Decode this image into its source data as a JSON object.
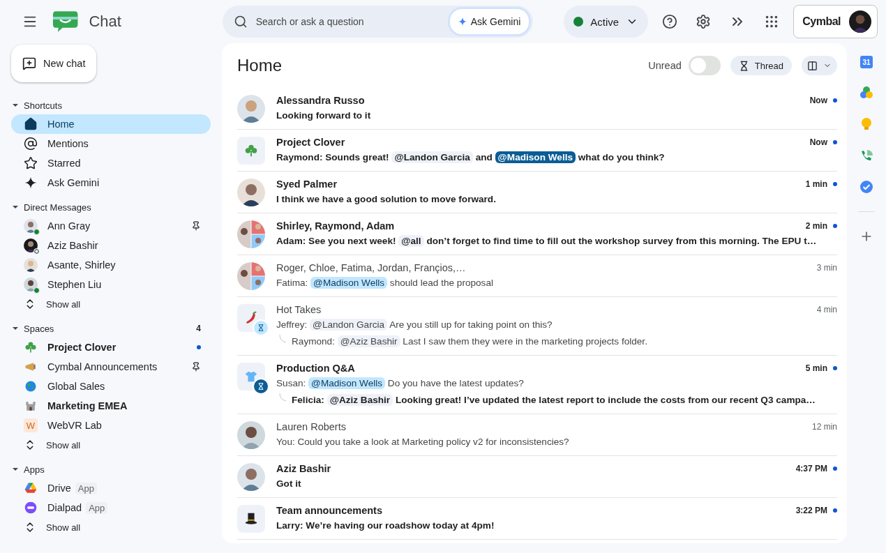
{
  "header": {
    "app_name": "Chat",
    "search": {
      "placeholder": "Search or ask a question"
    },
    "ask_button": "Ask Gemini",
    "status": {
      "label": "Active",
      "color": "#188038"
    },
    "account": {
      "brand": "Cymbal"
    }
  },
  "new_chat": "New chat",
  "sidebar": {
    "sections": [
      {
        "title": "Shortcuts",
        "expanded": true,
        "items": [
          {
            "kind": "home",
            "label": "Home",
            "selected": true,
            "bold": false,
            "pinned": false,
            "unread": false
          },
          {
            "kind": "mentions",
            "label": "Mentions",
            "selected": false,
            "bold": false,
            "pinned": false,
            "unread": false
          },
          {
            "kind": "starred",
            "label": "Starred",
            "selected": false,
            "bold": false,
            "pinned": false,
            "unread": false
          },
          {
            "kind": "gemini",
            "label": "Ask Gemini",
            "selected": false,
            "bold": false,
            "pinned": false,
            "unread": false
          }
        ]
      },
      {
        "title": "Direct Messages",
        "expanded": true,
        "items": [
          {
            "kind": "person",
            "label": "Ann Gray",
            "online": true,
            "away": false,
            "selected": false,
            "bold": false,
            "pinned": true,
            "unread": false
          },
          {
            "kind": "person",
            "label": "Aziz Bashir",
            "online": false,
            "away": true,
            "selected": false,
            "bold": false,
            "pinned": false,
            "unread": false
          },
          {
            "kind": "person",
            "label": "Asante, Shirley",
            "online": false,
            "away": false,
            "selected": false,
            "bold": false,
            "pinned": false,
            "unread": false
          },
          {
            "kind": "person",
            "label": "Stephen Liu",
            "online": true,
            "away": false,
            "selected": false,
            "bold": false,
            "pinned": false,
            "unread": false
          },
          {
            "kind": "showall",
            "label": "Show all",
            "selected": false,
            "pinned": false,
            "unread": false
          }
        ]
      },
      {
        "title": "Spaces",
        "count": "4",
        "expanded": true,
        "items": [
          {
            "kind": "clover",
            "label": "Project Clover",
            "selected": false,
            "bold": true,
            "pinned": false,
            "unread": true
          },
          {
            "kind": "megaphone",
            "label": "Cymbal Announcements",
            "selected": false,
            "bold": false,
            "pinned": true,
            "unread": false
          },
          {
            "kind": "globe",
            "label": "Global Sales",
            "selected": false,
            "bold": false,
            "pinned": false,
            "unread": false
          },
          {
            "kind": "castle",
            "label": "Marketing EMEA",
            "selected": false,
            "bold": true,
            "pinned": false,
            "unread": false
          },
          {
            "kind": "letter",
            "letter": "W",
            "label": "WebVR Lab",
            "selected": false,
            "bold": false,
            "pinned": false,
            "unread": false
          },
          {
            "kind": "showall",
            "label": "Show all",
            "selected": false,
            "pinned": false,
            "unread": false
          }
        ]
      },
      {
        "title": "Apps",
        "expanded": true,
        "items": [
          {
            "kind": "drive",
            "label": "Drive",
            "tag": "App",
            "selected": false,
            "bold": false,
            "pinned": false,
            "unread": false
          },
          {
            "kind": "dialpad",
            "label": "Dialpad",
            "tag": "App",
            "selected": false,
            "bold": false,
            "pinned": false,
            "unread": false
          },
          {
            "kind": "showall",
            "label": "Show all",
            "selected": false,
            "pinned": false,
            "unread": false
          }
        ]
      }
    ]
  },
  "main": {
    "title": "Home",
    "unread_toggle": {
      "label": "Unread",
      "on": false
    },
    "thread_button": "Thread"
  },
  "messages": [
    {
      "title": "Alessandra Russo",
      "time": "Now",
      "unread": true,
      "lines": [
        {
          "reply": false,
          "bold": true,
          "parts": [
            {
              "kind": "text",
              "text": "Looking forward to it"
            }
          ]
        }
      ]
    },
    {
      "kind": "clover",
      "title": "Project Clover",
      "time": "Now",
      "unread": true,
      "lines": [
        {
          "reply": false,
          "bold": true,
          "parts": [
            {
              "kind": "text",
              "text": "Raymond: Sounds great!"
            },
            {
              "kind": "mention",
              "text": "@Landon Garcia"
            },
            {
              "kind": "text",
              "text": "and"
            },
            {
              "kind": "mention-me",
              "text": "@Madison Wells"
            },
            {
              "kind": "text",
              "text": "what do you think?"
            }
          ]
        }
      ]
    },
    {
      "title": "Syed Palmer",
      "time": "1 min",
      "unread": true,
      "lines": [
        {
          "reply": false,
          "bold": true,
          "parts": [
            {
              "kind": "text",
              "text": "I think we have a good solution to move forward."
            }
          ]
        }
      ]
    },
    {
      "kind": "group",
      "title": "Shirley, Raymond, Adam",
      "time": "2 min",
      "unread": true,
      "lines": [
        {
          "reply": false,
          "bold": true,
          "parts": [
            {
              "kind": "text",
              "text": "Adam: See you next week!"
            },
            {
              "kind": "mention",
              "text": "@all"
            },
            {
              "kind": "text",
              "text": "don’t forget to find time to fill out the workshop survey from this morning. The EPU t…"
            }
          ]
        }
      ]
    },
    {
      "kind": "group",
      "title": "Roger, Chloe, Fatima, Jordan, Françios,…",
      "time": "3 min",
      "unread": false,
      "lines": [
        {
          "reply": false,
          "bold": false,
          "parts": [
            {
              "kind": "text",
              "text": "Fatima:"
            },
            {
              "kind": "mention-blue",
              "text": "@Madison Wells"
            },
            {
              "kind": "text",
              "text": "should lead the proposal"
            }
          ]
        }
      ]
    },
    {
      "kind": "pepper",
      "thread_badge": {
        "unread": false
      },
      "title": "Hot Takes",
      "time": "4 min",
      "unread": false,
      "lines": [
        {
          "reply": false,
          "bold": false,
          "parts": [
            {
              "kind": "text",
              "text": "Jeffrey:"
            },
            {
              "kind": "mention",
              "text": "@Landon Garcia"
            },
            {
              "kind": "text",
              "text": "Are you still up for taking point on this?"
            }
          ]
        },
        {
          "reply": true,
          "bold": false,
          "parts": [
            {
              "kind": "text",
              "text": "Raymond:"
            },
            {
              "kind": "mention",
              "text": "@Aziz Bashir"
            },
            {
              "kind": "text",
              "text": "Last I saw them they were in the marketing projects folder."
            }
          ]
        }
      ]
    },
    {
      "kind": "shirt",
      "thread_badge": {
        "unread": true
      },
      "title": "Production Q&A",
      "time": "5 min",
      "unread": true,
      "lines": [
        {
          "reply": false,
          "bold": false,
          "parts": [
            {
              "kind": "text",
              "text": "Susan:"
            },
            {
              "kind": "mention-blue",
              "text": "@Madison Wells"
            },
            {
              "kind": "text",
              "text": "Do you have the latest updates?"
            }
          ]
        },
        {
          "reply": true,
          "bold": true,
          "parts": [
            {
              "kind": "text",
              "text": "Felicia:"
            },
            {
              "kind": "mention",
              "text": "@Aziz Bashir"
            },
            {
              "kind": "text",
              "text": "Looking great! I’ve updated the latest report to include the costs from our recent Q3 campa…"
            }
          ]
        }
      ]
    },
    {
      "title": "Lauren Roberts",
      "time": "12 min",
      "unread": false,
      "lines": [
        {
          "reply": false,
          "bold": false,
          "parts": [
            {
              "kind": "text",
              "text": "You: Could you take a look at Marketing policy v2 for inconsistencies?"
            }
          ]
        }
      ]
    },
    {
      "title": "Aziz Bashir",
      "time": "4:37 PM",
      "unread": true,
      "lines": [
        {
          "reply": false,
          "bold": true,
          "parts": [
            {
              "kind": "text",
              "text": "Got it"
            }
          ]
        }
      ]
    },
    {
      "kind": "tophat",
      "title": "Team announcements",
      "time": "3:22 PM",
      "unread": true,
      "lines": [
        {
          "reply": false,
          "bold": true,
          "parts": [
            {
              "kind": "text",
              "text": "Larry: We’re having our roadshow today at 4pm!"
            }
          ]
        }
      ]
    }
  ],
  "right_rail": {
    "calendar_day": "31"
  }
}
